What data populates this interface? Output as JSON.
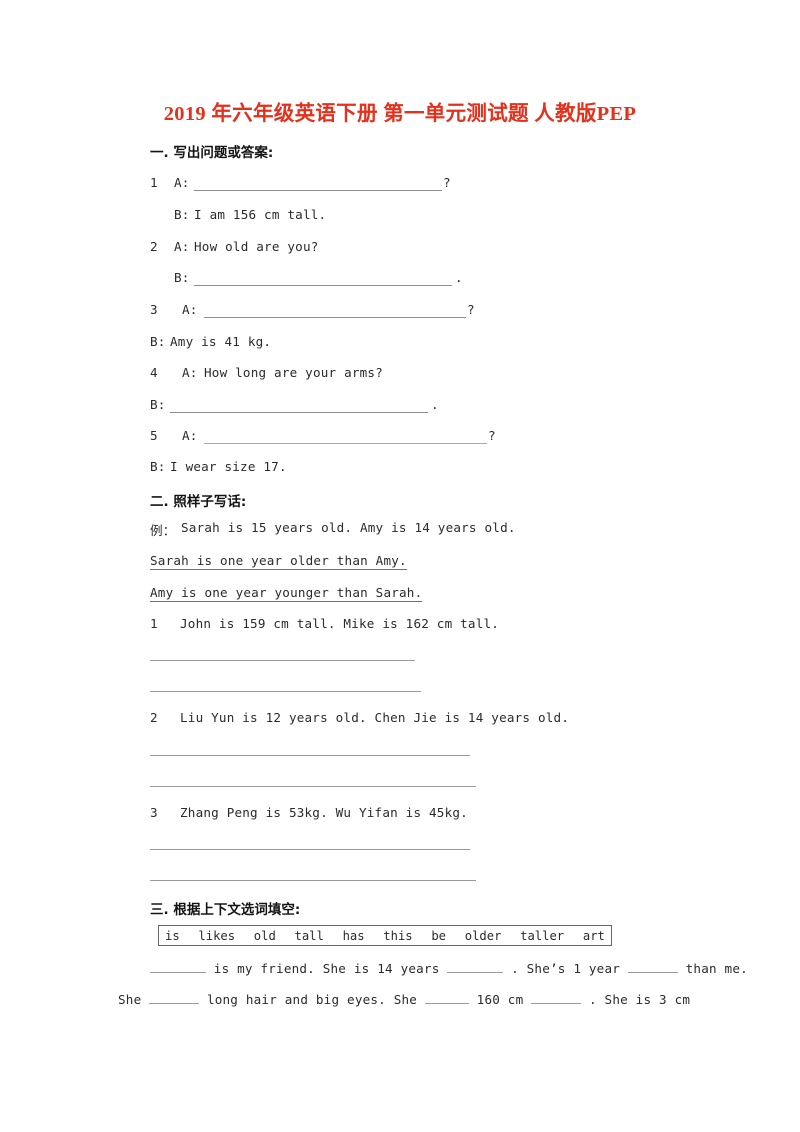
{
  "document": {
    "title": "2019 年六年级英语下册 第一单元测试题 人教版PEP",
    "title_color": "#e5301b"
  },
  "section1": {
    "heading": "一. 写出问题或答案:",
    "items": [
      {
        "num": "1",
        "a_label": "A:",
        "a_text": "",
        "a_tail": "?",
        "b_label": "B:",
        "b_text": "I am 156 cm tall."
      },
      {
        "num": "2",
        "a_label": "A:",
        "a_text": "How old are you?",
        "a_tail": "",
        "b_label": "B:",
        "b_text": "",
        "b_tail": "."
      },
      {
        "num": "3",
        "a_label": "A:",
        "a_text": "",
        "a_tail": "?",
        "b_label": "B:",
        "b_text": "Amy is 41 kg."
      },
      {
        "num": "4",
        "a_label": "A:",
        "a_text": "How long are your arms?",
        "a_tail": "",
        "b_label": "B:",
        "b_text": "",
        "b_tail": "."
      },
      {
        "num": "5",
        "a_label": "A:",
        "a_text": "",
        "a_tail": "?",
        "b_label": "B:",
        "b_text": "I wear size 17."
      }
    ]
  },
  "section2": {
    "heading": "二. 照样子写话:",
    "example_label": "例：",
    "example_text": "Sarah is 15 years old. Amy is 14 years old.",
    "model_lines": [
      "Sarah is one year older than Amy.",
      "Amy is one year younger than Sarah."
    ],
    "items": [
      {
        "num": "1",
        "text": "John is 159 cm tall. Mike is 162 cm tall."
      },
      {
        "num": "2",
        "text": "Liu Yun is 12 years old.  Chen Jie is 14 years old."
      },
      {
        "num": "3",
        "text": "Zhang Peng is 53kg. Wu Yifan is 45kg."
      }
    ]
  },
  "section3": {
    "heading": "三. 根据上下文选词填空:",
    "word_bank": [
      "is",
      "likes",
      "old",
      "tall",
      "has",
      "this",
      "be",
      "older",
      "taller",
      "art"
    ],
    "cloze_line1": {
      "t1": "is my friend. She is 14 years",
      "t2": ". She’s 1 year",
      "t3": "than me."
    },
    "cloze_line2": {
      "t0": "She",
      "t1": "long hair and big eyes. She",
      "t2": "160 cm",
      "t3": ". She is 3 cm"
    }
  }
}
